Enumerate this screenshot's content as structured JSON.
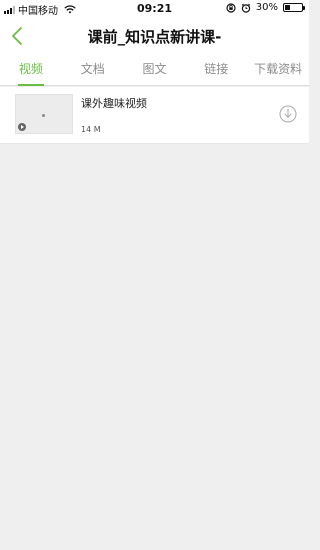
{
  "status_bar": {
    "carrier": "中国移动",
    "time": "09:21",
    "battery": "30%",
    "battery_level": 0.3,
    "icons": [
      "signal-icon",
      "wifi-icon",
      "orientation-lock-icon",
      "alarm-icon",
      "battery-icon"
    ]
  },
  "header": {
    "title": "课前_知识点新讲课-",
    "back_icon": "chevron-left-icon"
  },
  "tabs": [
    {
      "label": "视频",
      "active": true
    },
    {
      "label": "文档",
      "active": false
    },
    {
      "label": "图文",
      "active": false
    },
    {
      "label": "链接",
      "active": false
    },
    {
      "label": "下载资料",
      "active": false
    }
  ],
  "items": [
    {
      "title": "课外趣味视频",
      "size": "14 M",
      "icon": "download-icon"
    }
  ],
  "colors": {
    "accent": "#6abd45",
    "background": "#efefef",
    "tab_inactive": "#8c8c8c"
  }
}
